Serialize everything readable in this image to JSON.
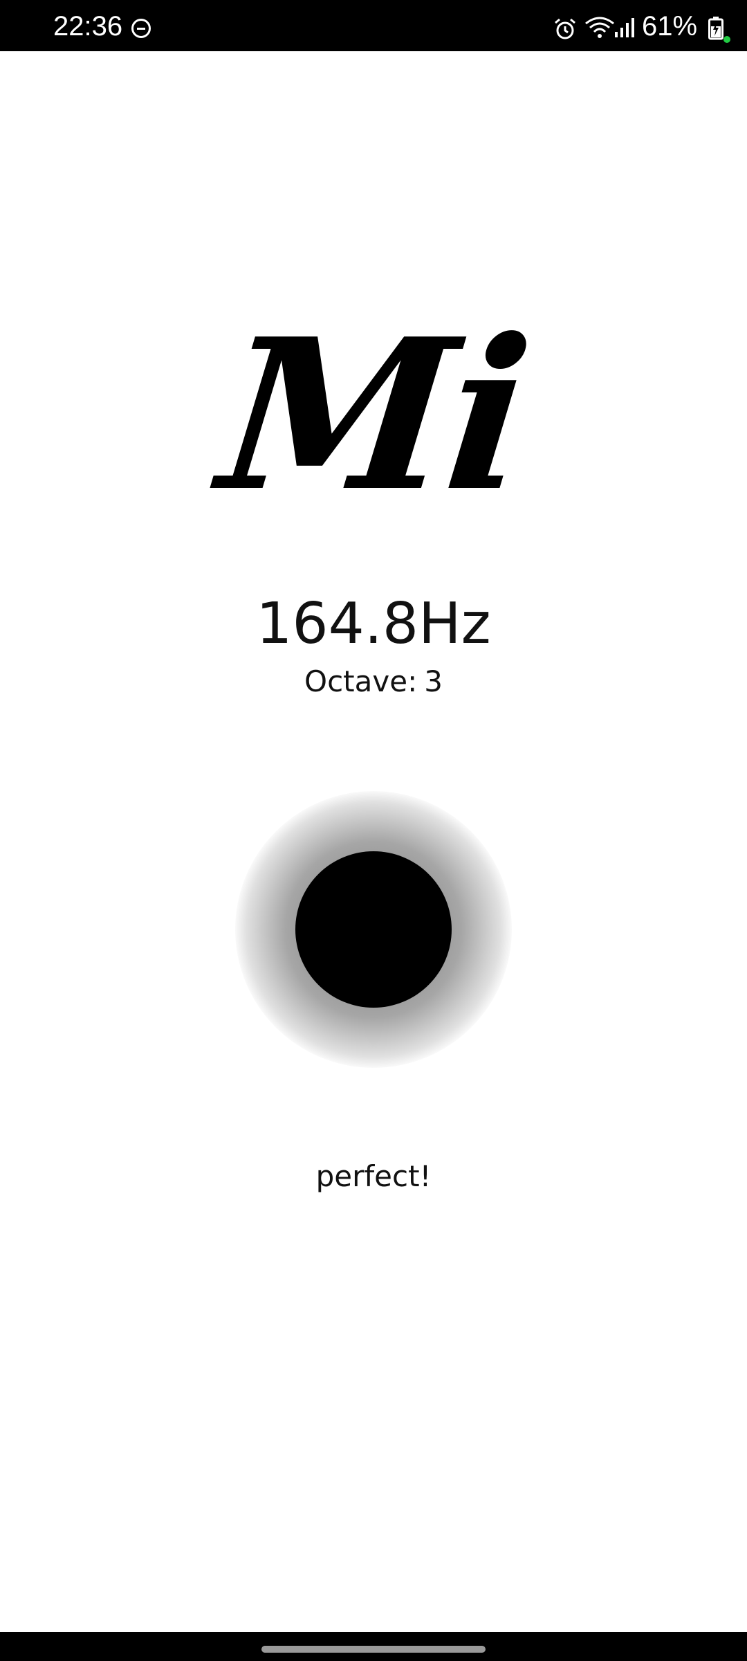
{
  "status_bar": {
    "time": "22:36",
    "battery_percent": "61%",
    "icons": [
      "do-not-disturb-icon",
      "alarm-icon",
      "wifi-icon",
      "signal-icon",
      "battery-charging-icon"
    ]
  },
  "tuner": {
    "note": "Mi",
    "frequency": "164.8Hz",
    "octave_label": "Octave:",
    "octave_value": "3",
    "message": "perfect!"
  }
}
